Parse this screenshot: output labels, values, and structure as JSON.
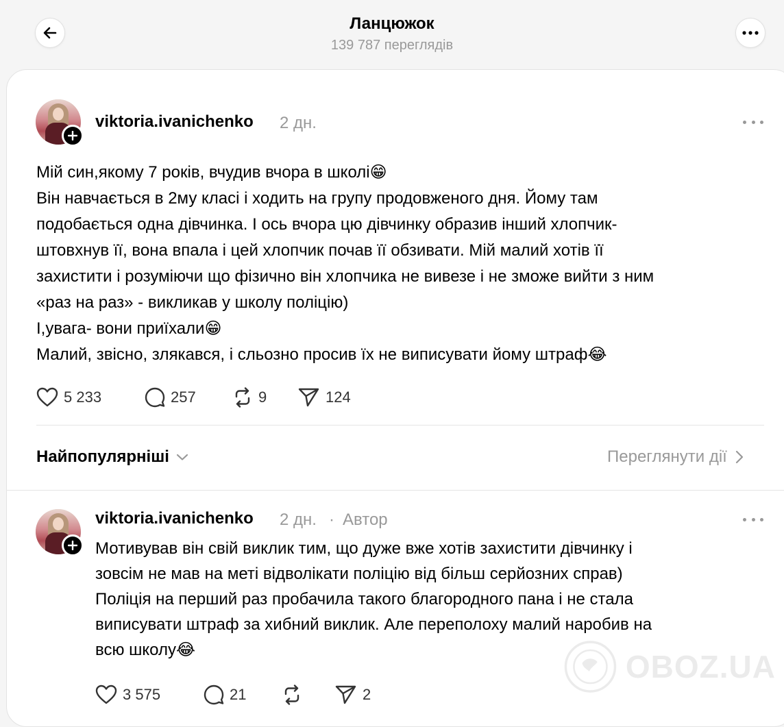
{
  "header": {
    "title": "Ланцюжок",
    "views": "139 787 переглядів"
  },
  "post": {
    "username": "viktoria.ivanichenko",
    "time": "2 дн.",
    "lines": [
      "Мій син,якому 7 років, вчудив вчора в школі😁",
      "Він навчається в 2му класі і ходить на групу продовженого дня. Йому там",
      "подобається одна дівчинка. І ось вчора цю дівчинку образив інший хлопчик-",
      "штовхнув її, вона впала і цей хлопчик почав її обзивати. Мій малий хотів її",
      "захистити і розуміючи що фізично він хлопчика не вивезе і не зможе вийти з ним",
      "«раз на раз» - викликав у школу поліцію)",
      "І,увага- вони приїхали😁",
      "Малий, звісно, злякався, і сльозно просив їх не виписувати йому штраф😂"
    ],
    "likes": "5 233",
    "comments": "257",
    "reposts": "9",
    "shares": "124"
  },
  "sort": {
    "label": "Найпопулярніші",
    "view_activity": "Переглянути дії"
  },
  "reply": {
    "username": "viktoria.ivanichenko",
    "time": "2 дн.",
    "separator": "·",
    "author_tag": "Автор",
    "lines": [
      "Мотивував він свій виклик тим, що дуже вже хотів захистити дівчинку і",
      "зовсім не мав на меті відволікати поліцію від більш серйозних справ)",
      "Поліція на перший раз пробачила такого благородного пана і не стала",
      "виписувати штраф за хибний виклик. Але переполоху малий наробив на",
      "всю школу😂"
    ],
    "likes": "3 575",
    "comments": "21",
    "shares": "2"
  },
  "watermark": {
    "text": "OBOZ.UA"
  },
  "icons": {
    "back": "arrow-left-icon",
    "more": "more-horizontal-icon",
    "like": "heart-icon",
    "comment": "comment-bubble-icon",
    "repost": "repost-arrows-icon",
    "share": "send-paper-plane-icon"
  }
}
